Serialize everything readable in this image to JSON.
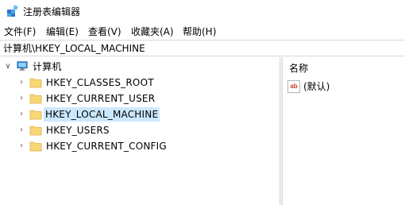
{
  "window": {
    "title": "注册表编辑器"
  },
  "menu": [
    {
      "label": "文件(F)"
    },
    {
      "label": "编辑(E)"
    },
    {
      "label": "查看(V)"
    },
    {
      "label": "收藏夹(A)"
    },
    {
      "label": "帮助(H)"
    }
  ],
  "address": {
    "path": "计算机\\HKEY_LOCAL_MACHINE"
  },
  "tree": {
    "root": {
      "label": "计算机",
      "expander": "∨",
      "icon": "computer-icon"
    },
    "children": [
      {
        "label": "HKEY_CLASSES_ROOT",
        "expander": "›",
        "icon": "folder-icon"
      },
      {
        "label": "HKEY_CURRENT_USER",
        "expander": "›",
        "icon": "folder-icon"
      },
      {
        "label": "HKEY_LOCAL_MACHINE",
        "expander": "›",
        "icon": "folder-icon",
        "selected": true
      },
      {
        "label": "HKEY_USERS",
        "expander": "›",
        "icon": "folder-icon"
      },
      {
        "label": "HKEY_CURRENT_CONFIG",
        "expander": "›",
        "icon": "folder-icon"
      }
    ]
  },
  "list": {
    "column_header": "名称",
    "values": [
      {
        "name": "(默认)",
        "icon": "string-value-icon",
        "icon_text": "ab"
      }
    ]
  },
  "colors": {
    "selection": "#cce8ff",
    "folder": "#f8d775",
    "folder_edge": "#dcb14a",
    "divider": "#d9d9d9"
  }
}
